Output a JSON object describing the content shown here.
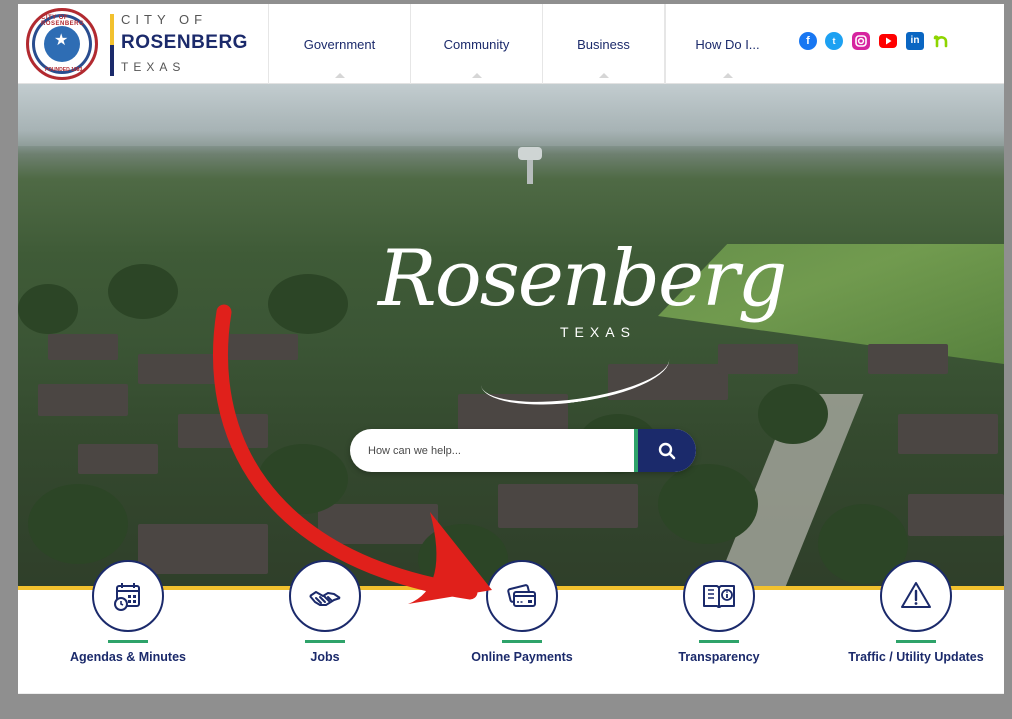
{
  "header": {
    "logo": {
      "city_prefix": "CITY OF",
      "city_name": "ROSENBERG",
      "state": "TEXAS",
      "seal_top_text": "CITY OF ROSENBERG",
      "seal_bottom_text": "FOUNDED 1883"
    },
    "nav": [
      {
        "label": "Government"
      },
      {
        "label": "Community"
      },
      {
        "label": "Business"
      },
      {
        "label": "How Do I..."
      }
    ],
    "social": [
      {
        "icon": "facebook-icon",
        "color": "#1877f2"
      },
      {
        "icon": "twitter-icon",
        "color": "#1da1f2"
      },
      {
        "icon": "instagram-icon",
        "color": "#d6249f"
      },
      {
        "icon": "youtube-icon",
        "color": "#ff0000"
      },
      {
        "icon": "linkedin-icon",
        "color": "#0a66c2"
      },
      {
        "icon": "nextdoor-icon",
        "color": "#8ed500"
      }
    ]
  },
  "hero": {
    "logo_script": "Rosenberg",
    "logo_state": "TEXAS",
    "search": {
      "placeholder": "How can we help...",
      "button_icon": "search-icon"
    }
  },
  "quick_links": [
    {
      "label": "Agendas & Minutes",
      "icon": "calendar-clock-icon"
    },
    {
      "label": "Jobs",
      "icon": "handshake-icon"
    },
    {
      "label": "Online Payments",
      "icon": "credit-card-icon"
    },
    {
      "label": "Transparency",
      "icon": "open-book-icon"
    },
    {
      "label": "Traffic / Utility Updates",
      "icon": "warning-icon"
    }
  ],
  "colors": {
    "navy": "#1b2a6b",
    "gold": "#f2c12e",
    "green": "#2ea36a",
    "annotation_red": "#e0201b"
  }
}
